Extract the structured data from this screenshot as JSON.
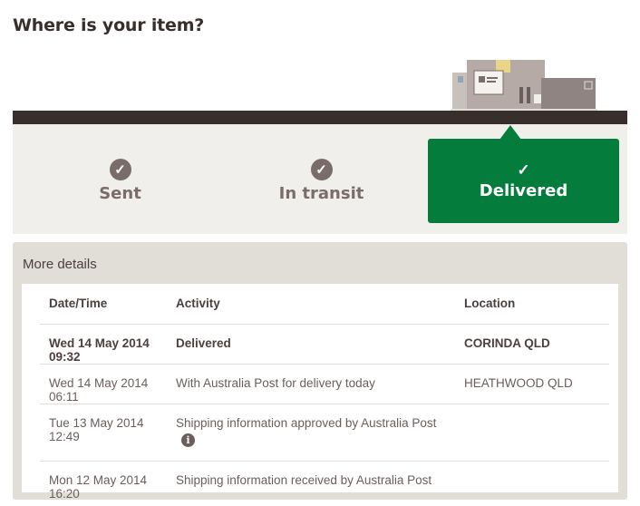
{
  "page": {
    "title": "Where is your item?"
  },
  "steps": [
    {
      "label": "Sent",
      "status": "complete"
    },
    {
      "label": "In transit",
      "status": "complete"
    },
    {
      "label": "Delivered",
      "status": "current"
    }
  ],
  "colors": {
    "accent": "#037c3c",
    "bar": "#382e2c",
    "muted": "#7a6d69"
  },
  "details": {
    "title": "More details",
    "headers": {
      "date": "Date/Time",
      "activity": "Activity",
      "location": "Location"
    },
    "rows": [
      {
        "date": "Wed 14 May 2014 09:32",
        "activity": "Delivered",
        "location": "CORINDA QLD"
      },
      {
        "date": "Wed 14 May 2014 06:11",
        "activity": "With Australia Post for delivery today",
        "location": "HEATHWOOD QLD"
      },
      {
        "date": "Tue 13 May 2014 12:49",
        "activity": "Shipping information approved by Australia Post",
        "location": "",
        "icon": "info-icon"
      },
      {
        "date": "Mon 12 May 2014 16:20",
        "activity": "Shipping information received by Australia Post",
        "location": ""
      }
    ]
  }
}
